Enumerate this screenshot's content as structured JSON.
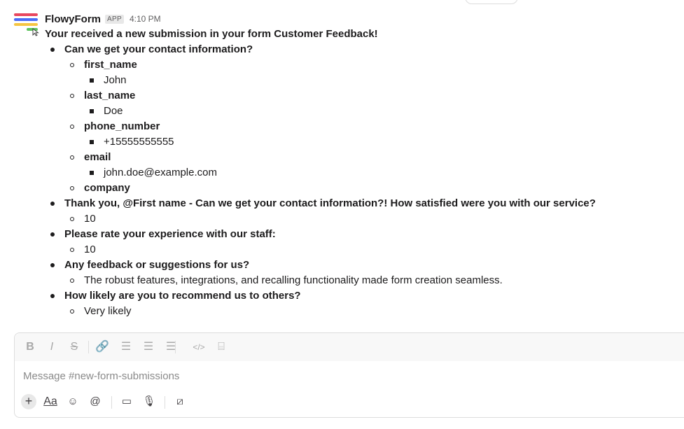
{
  "message": {
    "sender": "FlowyForm",
    "badge": "APP",
    "time": "4:10 PM",
    "intro": "Your received a new submission in your form Customer Feedback!",
    "lines": [
      {
        "text": "Can we get your contact information?",
        "level": 1,
        "bold": true
      },
      {
        "text": "first_name",
        "level": 2,
        "bold": true
      },
      {
        "text": "John",
        "level": 3,
        "bold": false
      },
      {
        "text": "last_name",
        "level": 2,
        "bold": true
      },
      {
        "text": "Doe",
        "level": 3,
        "bold": false
      },
      {
        "text": "phone_number",
        "level": 2,
        "bold": true
      },
      {
        "text": "+15555555555",
        "level": 3,
        "bold": false
      },
      {
        "text": "email",
        "level": 2,
        "bold": true
      },
      {
        "text": "john.doe@example.com",
        "level": 3,
        "bold": false
      },
      {
        "text": "company",
        "level": 2,
        "bold": true
      },
      {
        "text": "Thank you, @First name - Can we get your contact information?! How satisfied were you with our service?",
        "level": 1,
        "bold": true
      },
      {
        "text": "10",
        "level": 2,
        "bold": false
      },
      {
        "text": "Please rate your experience with our staff:",
        "level": 1,
        "bold": true
      },
      {
        "text": "10",
        "level": 2,
        "bold": false
      },
      {
        "text": "Any feedback or suggestions for us?",
        "level": 1,
        "bold": true
      },
      {
        "text": "The robust features, integrations, and recalling functionality made form creation seamless.",
        "level": 2,
        "bold": false
      },
      {
        "text": "How likely are you to recommend us to others?",
        "level": 1,
        "bold": true
      },
      {
        "text": "Very likely",
        "level": 2,
        "bold": false
      }
    ]
  },
  "composer": {
    "placeholder": "Message #new-form-submissions",
    "formatting": [
      {
        "name": "bold-icon",
        "glyph": "B"
      },
      {
        "name": "italic-icon",
        "glyph": "I"
      },
      {
        "name": "strikethrough-icon",
        "glyph": "S"
      },
      {
        "name": "link-icon",
        "glyph": "🔗"
      },
      {
        "name": "ordered-list-icon",
        "glyph": "☰"
      },
      {
        "name": "bulleted-list-icon",
        "glyph": "☰"
      },
      {
        "name": "blockquote-icon",
        "glyph": "☰"
      },
      {
        "name": "code-icon",
        "glyph": "</>"
      },
      {
        "name": "code-block-icon",
        "glyph": "⌸"
      }
    ],
    "actions": [
      {
        "name": "attach-plus-icon",
        "glyph": "+"
      },
      {
        "name": "text-format-icon",
        "glyph": "Aa"
      },
      {
        "name": "emoji-icon",
        "glyph": "☺"
      },
      {
        "name": "mention-icon",
        "glyph": "@"
      },
      {
        "name": "video-icon",
        "glyph": "▭"
      },
      {
        "name": "microphone-icon",
        "glyph": "🎙"
      },
      {
        "name": "shortcuts-icon",
        "glyph": "⧄"
      }
    ]
  },
  "colors": {
    "accent_red": "#e8475f",
    "accent_blue": "#4a6cf7",
    "accent_yellow": "#f5c542",
    "accent_green": "#5cc35c"
  }
}
